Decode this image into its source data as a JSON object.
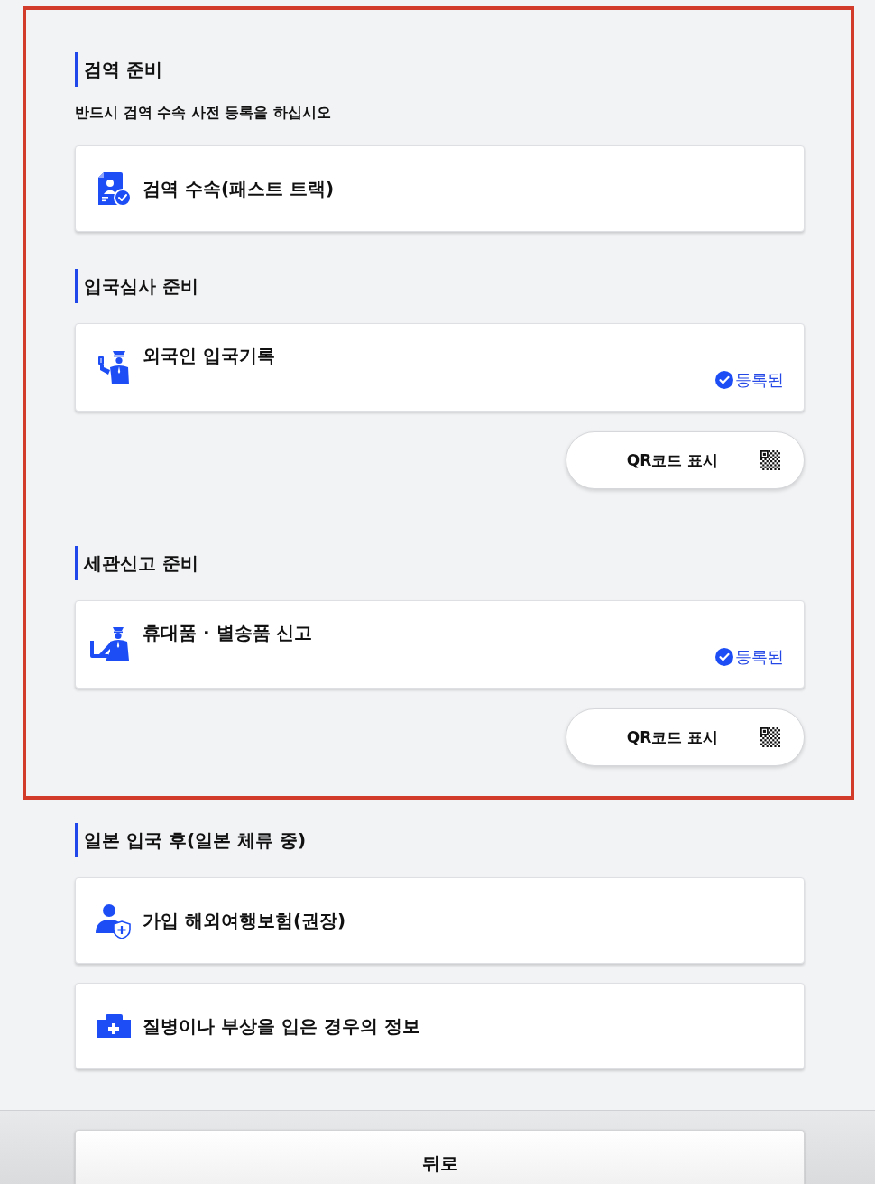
{
  "sections": [
    {
      "heading": "검역 준비",
      "highlighted": true,
      "note": "반드시 검역 수속 사전 등록을 하십시오",
      "items": [
        {
          "kind": "quarantine",
          "label": "검역 수속(패스트 트랙)"
        }
      ]
    },
    {
      "heading": "입국심사 준비",
      "highlighted": true,
      "items": [
        {
          "kind": "immigration",
          "label": "외국인 입국기록",
          "status": "등록된",
          "qr_button": "QR코드 표시"
        }
      ]
    },
    {
      "heading": "세관신고 준비",
      "highlighted": true,
      "items": [
        {
          "kind": "customs",
          "label": "휴대품 · 별송품 신고",
          "status": "등록된",
          "qr_button": "QR코드 표시"
        }
      ]
    },
    {
      "heading": "일본 입국 후(일본 체류 중)",
      "highlighted": false,
      "items": [
        {
          "kind": "insurance",
          "label": "가입 해외여행보험(권장)"
        },
        {
          "kind": "medical",
          "label": "질병이나 부상을 입은 경우의 정보"
        }
      ]
    }
  ],
  "footer": {
    "back_button": "뒤로"
  }
}
